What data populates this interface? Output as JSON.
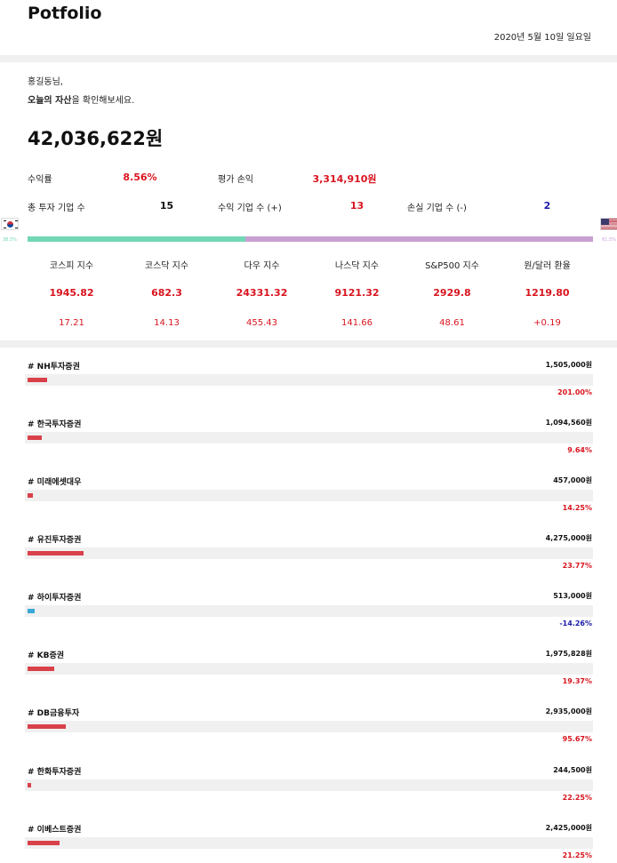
{
  "header": {
    "title": "Potfolio",
    "date": "2020년 5월 10일 일요일"
  },
  "greeting": {
    "name_line": "홍길동님,",
    "prompt_bold": "오늘의 자산",
    "prompt_rest": "을 확인해보세요."
  },
  "summary": {
    "total": "42,036,622원",
    "return_label": "수익률",
    "return_value": "8.56%",
    "pnl_label": "평가 손익",
    "pnl_value": "3,314,910원",
    "companies_label": "총 투자 기업 수",
    "companies_value": "15",
    "profit_label": "수익 기업 수 (+)",
    "profit_value": "13",
    "loss_label": "손실 기업 수 (-)",
    "loss_value": "2"
  },
  "allocation": {
    "korea_icon": "korea-flag-icon",
    "us_icon": "us-flag-icon",
    "korea_pct_label": "38.5%",
    "us_pct_label": "61.5%",
    "korea_share": 0.385,
    "korea_color": "#71d7b5",
    "us_color": "#c7a0d2"
  },
  "indices": [
    {
      "name": "코스피 지수",
      "value": "1945.82",
      "change": "17.21"
    },
    {
      "name": "코스닥 지수",
      "value": "682.3",
      "change": "14.13"
    },
    {
      "name": "다우 지수",
      "value": "24331.32",
      "change": "455.43"
    },
    {
      "name": "나스닥 지수",
      "value": "9121.32",
      "change": "141.66"
    },
    {
      "name": "S&P500 지수",
      "value": "2929.8",
      "change": "48.61"
    },
    {
      "name": "원/달러 환율",
      "value": "1219.80",
      "change": "+0.19"
    }
  ],
  "accounts": [
    {
      "name": "# NH투자증권",
      "amount": "1,505,000원",
      "rate": "201.00%",
      "bar_level": 0.035,
      "positive": true
    },
    {
      "name": "# 한국투자증권",
      "amount": "1,094,560원",
      "rate": "9.64%",
      "bar_level": 0.025,
      "positive": true
    },
    {
      "name": "# 미래에셋대우",
      "amount": "457,000원",
      "rate": "14.25%",
      "bar_level": 0.01,
      "positive": true
    },
    {
      "name": "# 유진투자증권",
      "amount": "4,275,000원",
      "rate": "23.77%",
      "bar_level": 0.1,
      "positive": true
    },
    {
      "name": "# 하이투자증권",
      "amount": "513,000원",
      "rate": "-14.26%",
      "bar_level": 0.013,
      "positive": false
    },
    {
      "name": "# KB증권",
      "amount": "1,975,828원",
      "rate": "19.37%",
      "bar_level": 0.047,
      "positive": true
    },
    {
      "name": "# DB금융투자",
      "amount": "2,935,000원",
      "rate": "95.67%",
      "bar_level": 0.069,
      "positive": true
    },
    {
      "name": "# 한화투자증권",
      "amount": "244,500원",
      "rate": "22.25%",
      "bar_level": 0.006,
      "positive": true
    },
    {
      "name": "# 이베스트증권",
      "amount": "2,425,000원",
      "rate": "21.25%",
      "bar_level": 0.057,
      "positive": true
    }
  ],
  "colors": {
    "positive": "#d8141e",
    "negative": "#1a1aa8",
    "bar_positive": "#d9414a",
    "bar_negative": "#3aa7d6"
  }
}
